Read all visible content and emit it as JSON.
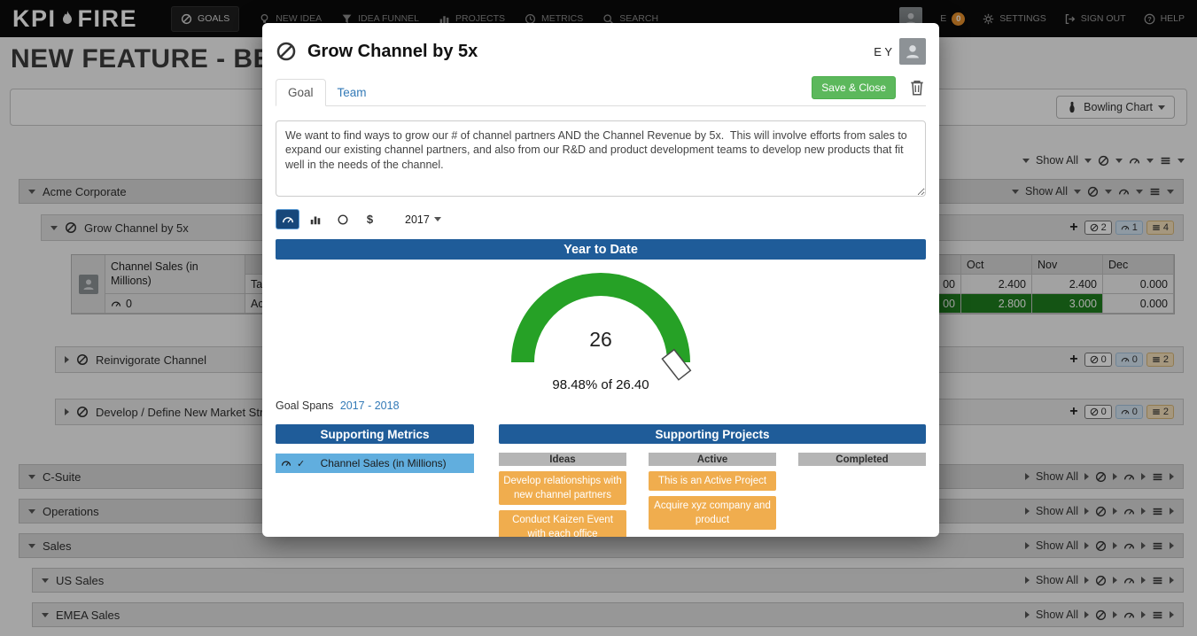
{
  "colors": {
    "blue": "#1F5C99",
    "gauge-green": "#26A126",
    "cell-green": "#1E7E1E",
    "save-green": "#5CB85C",
    "orange": "#F0AD4E",
    "metric-blue": "#61AEDE",
    "link-blue": "#337AB7",
    "badge-orange": "#E8912D"
  },
  "icons": {
    "plus": "+",
    "check": "✓",
    "dollar": "$",
    "flame-icon": "flame",
    "goals-icon": "target-slash",
    "new-idea-icon": "lightbulb",
    "idea-funnel-icon": "funnel",
    "projects-icon": "bar-chart",
    "metrics-icon": "clock",
    "search-icon": "magnifier",
    "settings-icon": "gear",
    "signout-icon": "exit-arrow",
    "help-icon": "question-circle",
    "trash-icon": "trash-can",
    "gauge-icon": "speedometer",
    "list-icon": "list-lines",
    "bowling-icon": "bowling-pin",
    "person-icon": "person-silhouette",
    "caret-icon": "triangle"
  },
  "nav": {
    "logo_prefix": "KPI",
    "logo_suffix": "FIRE",
    "items": [
      {
        "label": "GOALS"
      },
      {
        "label": "NEW IDEA"
      },
      {
        "label": "IDEA FUNNEL"
      },
      {
        "label": "PROJECTS"
      },
      {
        "label": "METRICS"
      },
      {
        "label": "SEARCH"
      }
    ],
    "user_initial": "E",
    "user_badge": "0",
    "settings_label": "SETTINGS",
    "signout_label": "SIGN OUT",
    "help_label": "HELP"
  },
  "page": {
    "heading": "NEW FEATURE - BE",
    "bowling_chart_button": "Bowling Chart",
    "show_all": "Show All"
  },
  "tree": {
    "sections": {
      "acme": "Acme Corporate",
      "c_suite": "C-Suite",
      "operations": "Operations",
      "sales": "Sales",
      "us_sales": "US Sales",
      "emea_sales": "EMEA Sales"
    },
    "goals": [
      {
        "label": "Grow Channel by 5x",
        "goals_count": "2",
        "metrics_count": "1",
        "projects_count": "4"
      },
      {
        "label": "Reinvigorate Channel",
        "goals_count": "0",
        "metrics_count": "0",
        "projects_count": "2"
      },
      {
        "label": "Develop / Define New Market Strat",
        "goals_count": "0",
        "metrics_count": "0",
        "projects_count": "2"
      }
    ],
    "bowling": {
      "metric_label": "Channel Sales (in Millions)",
      "metric_count": "0",
      "months": [
        "Oct",
        "Nov",
        "Dec"
      ],
      "rows": [
        {
          "type": "Target",
          "cut": "00",
          "values": [
            "2.400",
            "2.400",
            "0.000"
          ]
        },
        {
          "type": "Actual",
          "cut": "00",
          "values": [
            "2.800",
            "3.000",
            "0.000"
          ]
        }
      ]
    }
  },
  "modal": {
    "title": "Grow Channel by 5x",
    "owner_initials": "E Y",
    "tabs": {
      "goal": "Goal",
      "team": "Team"
    },
    "save_button": "Save & Close",
    "description": "We want to find ways to grow our # of channel partners AND the Channel Revenue by 5x.  This will involve efforts from sales to expand our existing channel partners, and also from our R&D and product development teams to develop new products that fit well in the needs of the channel.",
    "year_dropdown": "2017",
    "ytd_header": "Year to Date",
    "gauge": {
      "value": "26",
      "caption": "98.48% of 26.40"
    },
    "goal_spans_label": "Goal Spans",
    "goal_spans_range": "2017 - 2018",
    "metrics": {
      "header": "Supporting Metrics",
      "items": [
        {
          "label": "Channel Sales (in Millions)"
        }
      ]
    },
    "projects": {
      "header": "Supporting Projects",
      "columns": [
        {
          "label": "Ideas",
          "cards": [
            "Develop relationships with new channel partners",
            "Conduct Kaizen Event with each office"
          ]
        },
        {
          "label": "Active",
          "cards": [
            "This is an Active Project",
            "Acquire xyz company and product"
          ]
        },
        {
          "label": "Completed",
          "cards": []
        }
      ]
    }
  }
}
